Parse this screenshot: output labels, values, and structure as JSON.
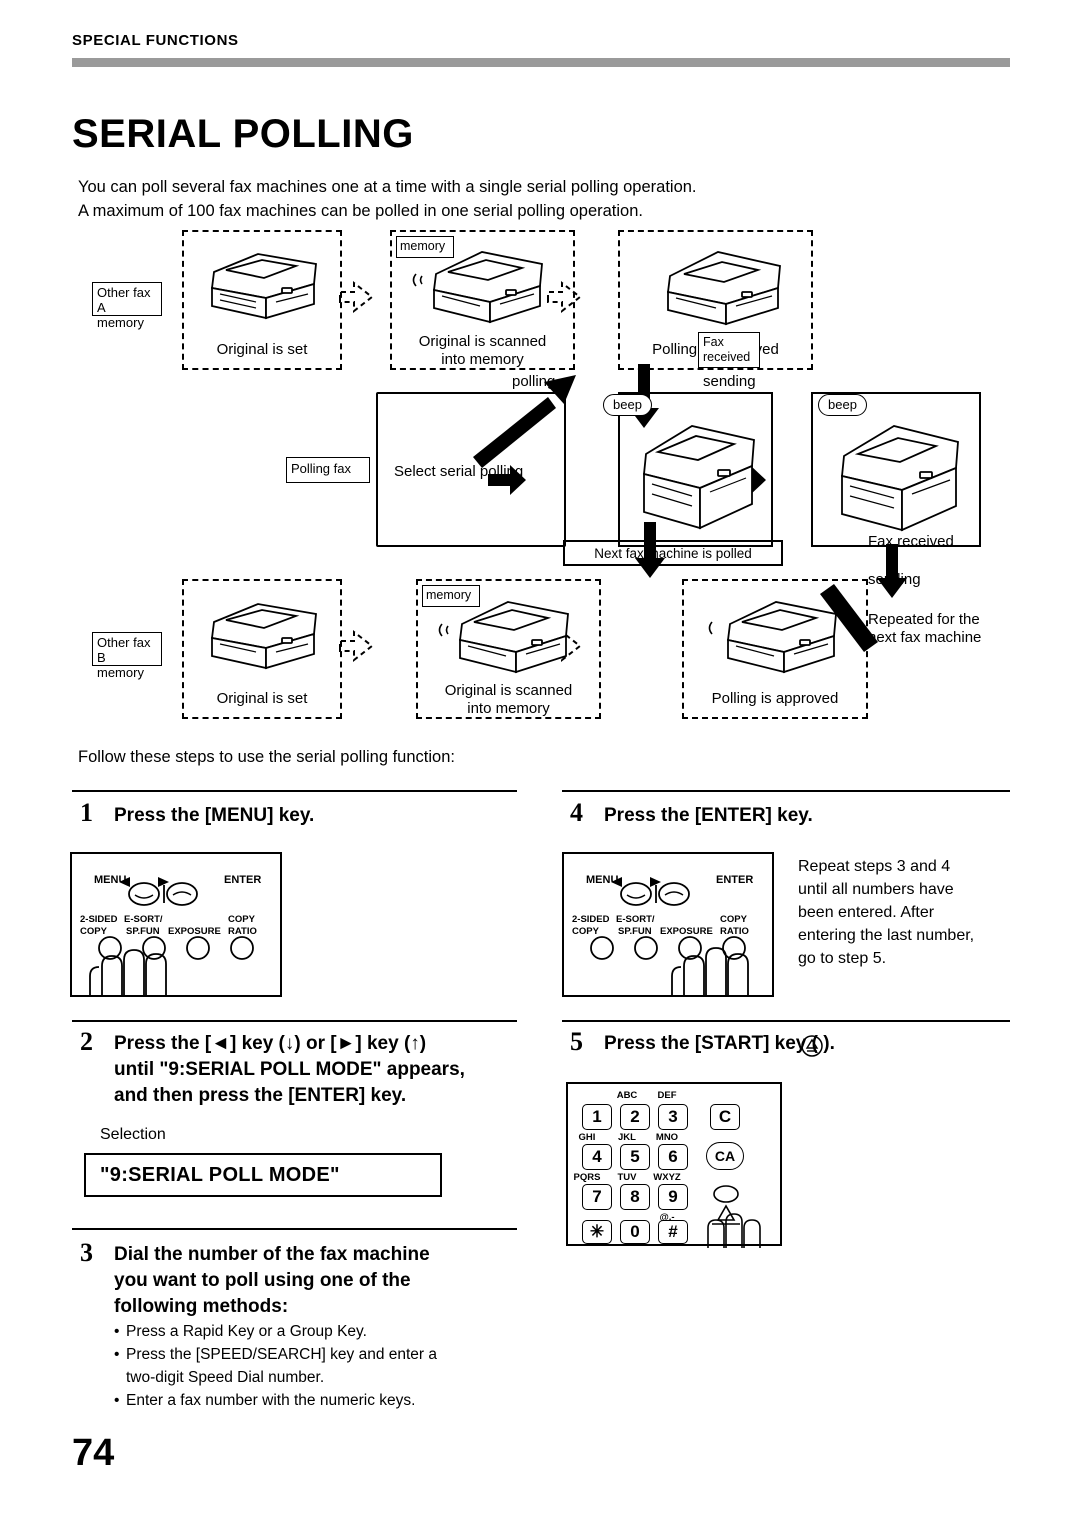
{
  "header": {
    "section_label": "SPECIAL FUNCTIONS"
  },
  "title": "SERIAL POLLING",
  "intro": {
    "line1": "You can poll several fax machines one at a time with a single serial polling operation.",
    "line2": "A maximum of 100 fax machines can be polled in one serial polling operation."
  },
  "diagram": {
    "other_fax_a": "Other fax A\nmemory",
    "other_fax_a_l1": "Other fax A",
    "other_fax_a_l2": "memory",
    "other_fax_b_l1": "Other fax B",
    "other_fax_b_l2": "memory",
    "memory_tag_top": "memory",
    "memory_tag_bottom": "memory",
    "original_is_set_top": "Original is set",
    "original_is_set_bottom": "Original is set",
    "scanned_top_l1": "Original is scanned",
    "scanned_top_l2": "into memory",
    "scanned_bottom_l1": "Original is scanned",
    "scanned_bottom_l2": "into memory",
    "polling_approved_top": "Polling is approved",
    "polling_approved_bottom": "Polling is approved",
    "polling_fax_tag": "Polling fax",
    "select_serial_polling": "Select serial polling",
    "polling_label": "polling",
    "sending_label_top": "sending",
    "sending_label_bottom": "sending",
    "fax_received_tag_l1": "Fax",
    "fax_received_tag_l2": "received",
    "beep_left": "beep",
    "beep_right": "beep",
    "fax_received_right": "Fax received",
    "next_fax_polled": "Next fax machine is polled",
    "repeated_l1": "Repeated for the",
    "repeated_l2": "next fax machine"
  },
  "follow_text": "Follow these steps to use the serial polling function:",
  "steps": [
    {
      "number": "1",
      "heading": "Press the [MENU] key."
    },
    {
      "number": "2",
      "heading_l1": "Press the [◄] key (↓) or [►] key (↑)",
      "heading_l2": "until \"9:SERIAL POLL MODE\" appears,",
      "heading_l3": "and then press the [ENTER] key.",
      "selection_label": "Selection",
      "selection_value": "\"9:SERIAL POLL MODE\""
    },
    {
      "number": "3",
      "heading_l1": "Dial the number of the fax machine",
      "heading_l2": "you want to poll using one of the",
      "heading_l3": "following methods:",
      "bullets": [
        "Press a Rapid Key or a Group Key.",
        "Press the [SPEED/SEARCH] key and enter a",
        "two-digit Speed Dial number.",
        "Enter a fax number with the numeric keys."
      ],
      "bullet1": "Press a Rapid Key or a Group Key.",
      "bullet2_l1": "Press the [SPEED/SEARCH] key and enter a",
      "bullet2_l2": "two-digit Speed Dial number.",
      "bullet3": "Enter a fax number with the numeric keys."
    },
    {
      "number": "4",
      "heading": "Press the [ENTER] key.",
      "body_l1": "Repeat steps 3 and 4",
      "body_l2": "until all numbers have",
      "body_l3": "been entered. After",
      "body_l4": "entering the last number,",
      "body_l5": "go to step 5."
    },
    {
      "number": "5",
      "heading": "Press the [START] key (   )."
    }
  ],
  "panel": {
    "menu": "MENU",
    "enter": "ENTER",
    "two_sided_l1": "2-SIDED",
    "two_sided_l2": "COPY",
    "esort_l1": "E-SORT/",
    "esort_l2": "SP.FUN",
    "exposure": "EXPOSURE",
    "copy_l1": "COPY",
    "copy_l2": "RATIO"
  },
  "keypad": {
    "labels": {
      "abc": "ABC",
      "def": "DEF",
      "ghi": "GHI",
      "jkl": "JKL",
      "mno": "MNO",
      "pqrs": "PQRS",
      "tuv": "TUV",
      "wxyz": "WXYZ",
      "atsign": "@.-"
    },
    "keys": [
      "1",
      "2",
      "3",
      "C",
      "4",
      "5",
      "6",
      "CA",
      "7",
      "8",
      "9",
      "✳",
      "0",
      "#"
    ],
    "k1": "1",
    "k2": "2",
    "k3": "3",
    "kC": "C",
    "k4": "4",
    "k5": "5",
    "k6": "6",
    "kCA": "CA",
    "k7": "7",
    "k8": "8",
    "k9": "9",
    "kstar": "✳",
    "k0": "0",
    "khash": "#"
  },
  "page_number": "74"
}
